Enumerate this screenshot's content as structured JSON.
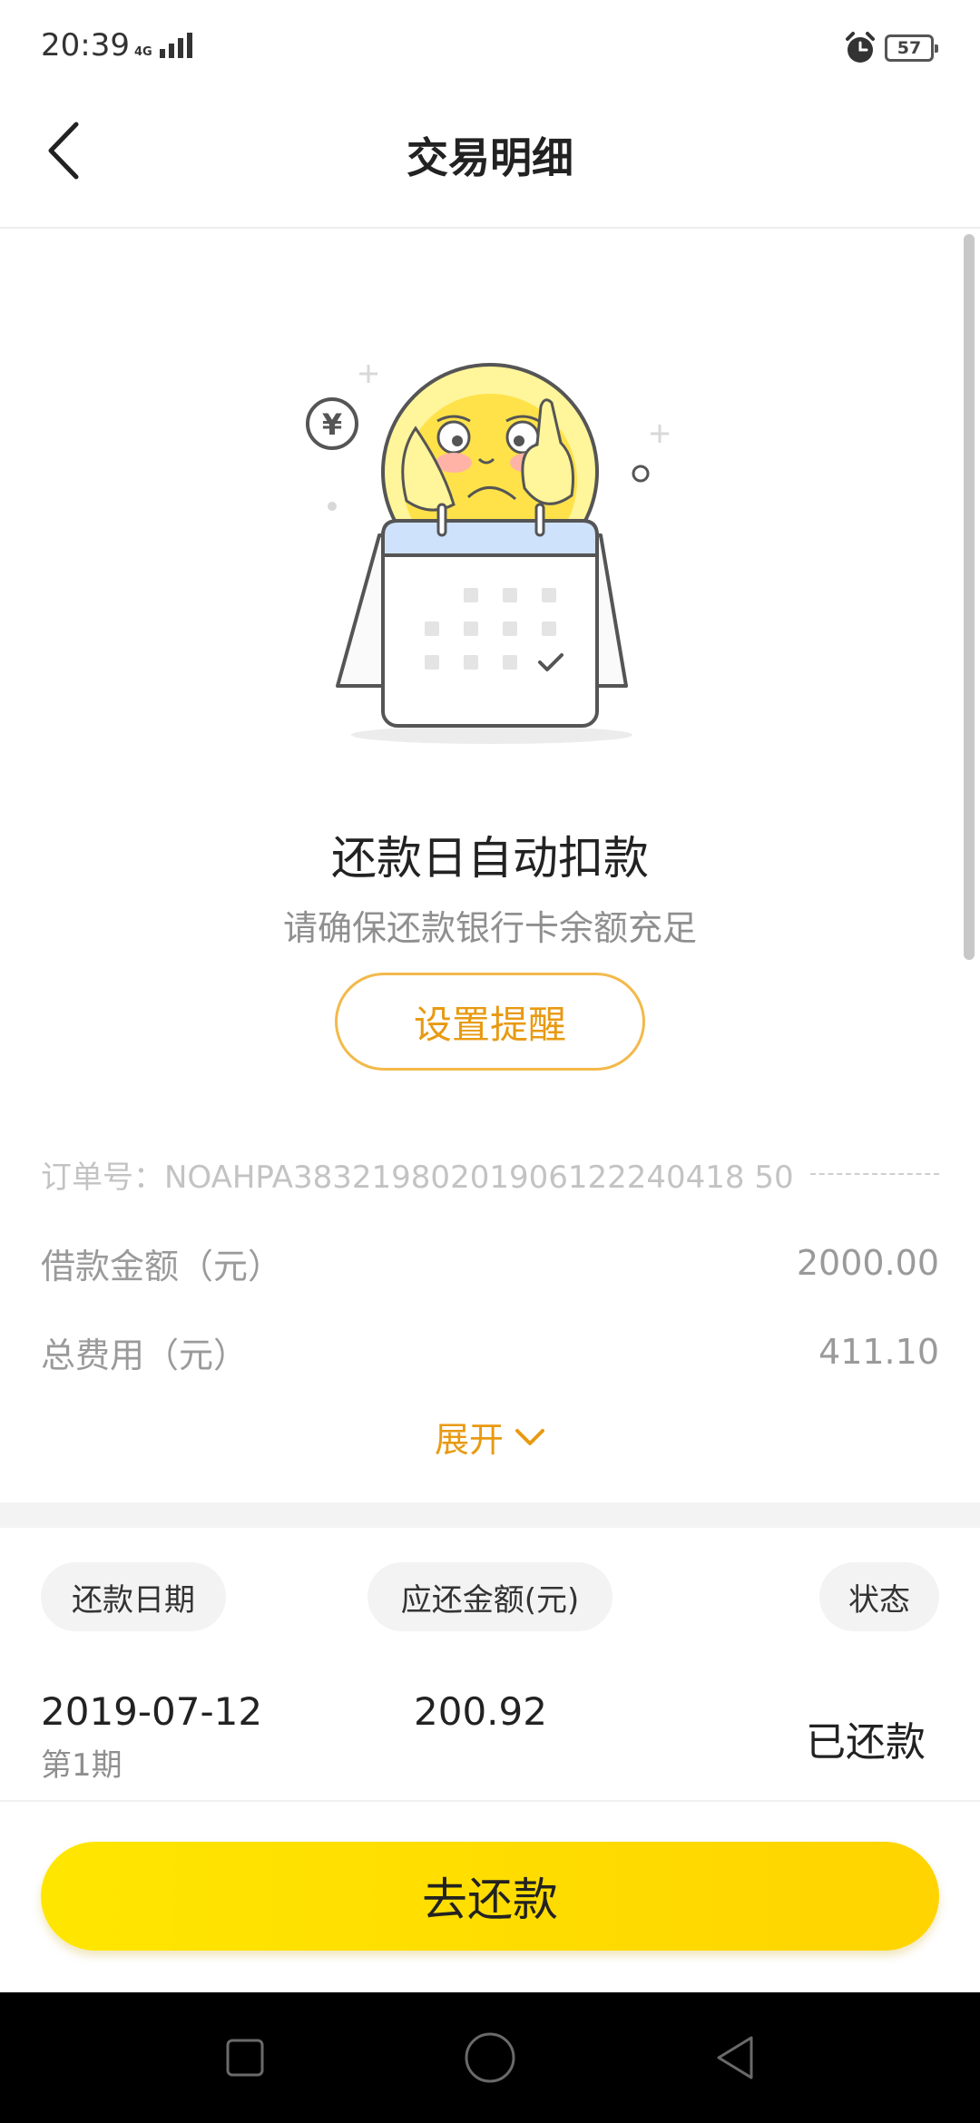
{
  "status_bar": {
    "time": "20:39",
    "network": "4G",
    "battery": "57"
  },
  "header": {
    "title": "交易明细",
    "back_icon": "chevron-left-icon"
  },
  "reminder": {
    "title": "还款日自动扣款",
    "subtitle": "请确保还款银行卡余额充足",
    "button_label": "设置提醒"
  },
  "order": {
    "number_label": "订单号：NOAHPA38321980201906122240418 50"
  },
  "loan": {
    "amount_label": "借款金额（元）",
    "amount_value": "2000.00",
    "fee_label": "总费用（元）",
    "fee_value": "411.10",
    "expand_label": "展开"
  },
  "table": {
    "headers": [
      "还款日期",
      "应还金额(元)",
      "状态"
    ],
    "rows": [
      {
        "date": "2019-07-12",
        "period": "第1期",
        "amount": "200.92",
        "status": "已还款"
      }
    ]
  },
  "actions": {
    "repay_label": "去还款"
  },
  "colors": {
    "accent": "#e89a12",
    "button_yellow": "#ffde00"
  }
}
